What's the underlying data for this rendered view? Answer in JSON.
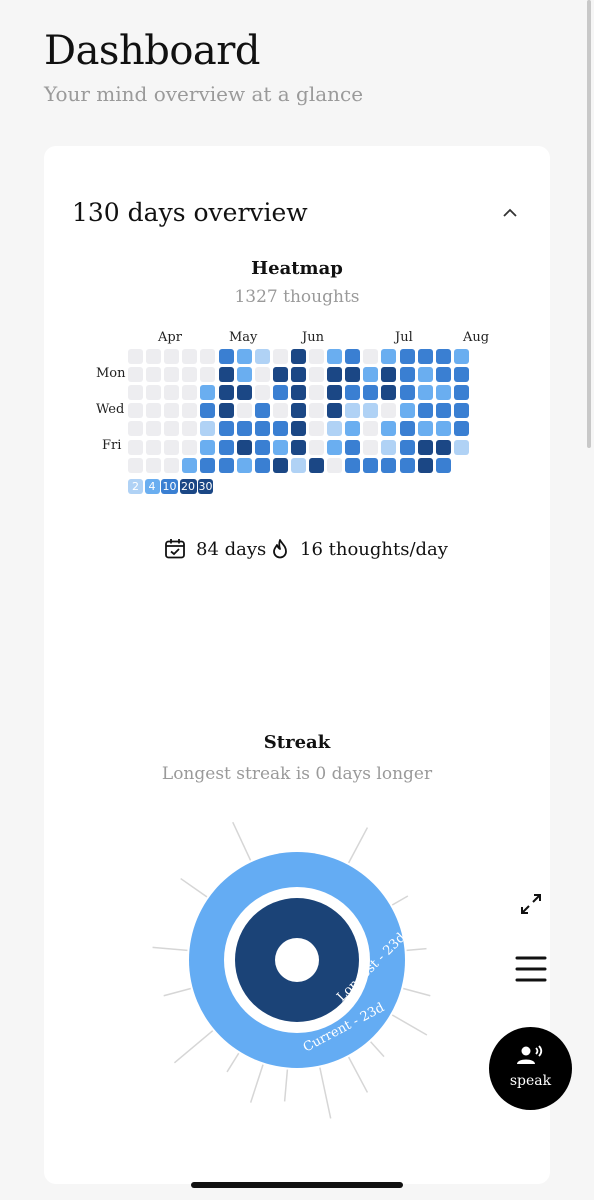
{
  "header": {
    "title": "Dashboard",
    "subtitle": "Your mind overview at a glance"
  },
  "overview": {
    "title": "130 days overview"
  },
  "heatmap": {
    "title": "Heatmap",
    "subtitle": "1327 thoughts",
    "months": [
      "Apr",
      "May",
      "Jun",
      "Jul",
      "Aug"
    ],
    "day_labels": [
      "Mon",
      "Wed",
      "Fri"
    ],
    "legend": [
      "2",
      "4",
      "10",
      "20",
      "30"
    ],
    "colors": [
      "#ededf0",
      "#b0d2f5",
      "#6aaef0",
      "#3a7fd2",
      "#1b4785"
    ],
    "grid": [
      [
        0,
        0,
        0,
        0,
        0,
        3,
        2,
        1,
        0,
        4,
        0,
        2,
        3,
        0,
        2,
        3,
        3,
        3,
        2
      ],
      [
        0,
        0,
        0,
        0,
        0,
        4,
        2,
        0,
        4,
        4,
        0,
        4,
        4,
        2,
        4,
        3,
        2,
        3,
        3
      ],
      [
        0,
        0,
        0,
        0,
        2,
        4,
        4,
        0,
        3,
        4,
        0,
        4,
        3,
        3,
        4,
        3,
        2,
        2,
        3
      ],
      [
        0,
        0,
        0,
        0,
        3,
        4,
        0,
        3,
        0,
        4,
        0,
        4,
        1,
        1,
        0,
        2,
        3,
        3,
        3
      ],
      [
        0,
        0,
        0,
        0,
        1,
        3,
        3,
        3,
        3,
        4,
        0,
        1,
        2,
        0,
        2,
        3,
        2,
        2,
        3
      ],
      [
        0,
        0,
        0,
        0,
        2,
        3,
        4,
        3,
        2,
        4,
        0,
        2,
        3,
        0,
        1,
        3,
        4,
        4,
        1
      ],
      [
        0,
        0,
        0,
        2,
        3,
        3,
        2,
        3,
        4,
        1,
        4,
        0,
        3,
        3,
        3,
        3,
        4,
        3,
        -1
      ]
    ]
  },
  "stats": {
    "days": "84 days",
    "rate": "16 thoughts/day"
  },
  "streak": {
    "title": "Streak",
    "subtitle": "Longest streak is 0 days longer",
    "current_label": "Current - 23d",
    "longest_label": "Longest - 23d",
    "current_color": "#64acf3",
    "longest_color": "#1b4377"
  },
  "speak": {
    "label": "speak"
  }
}
